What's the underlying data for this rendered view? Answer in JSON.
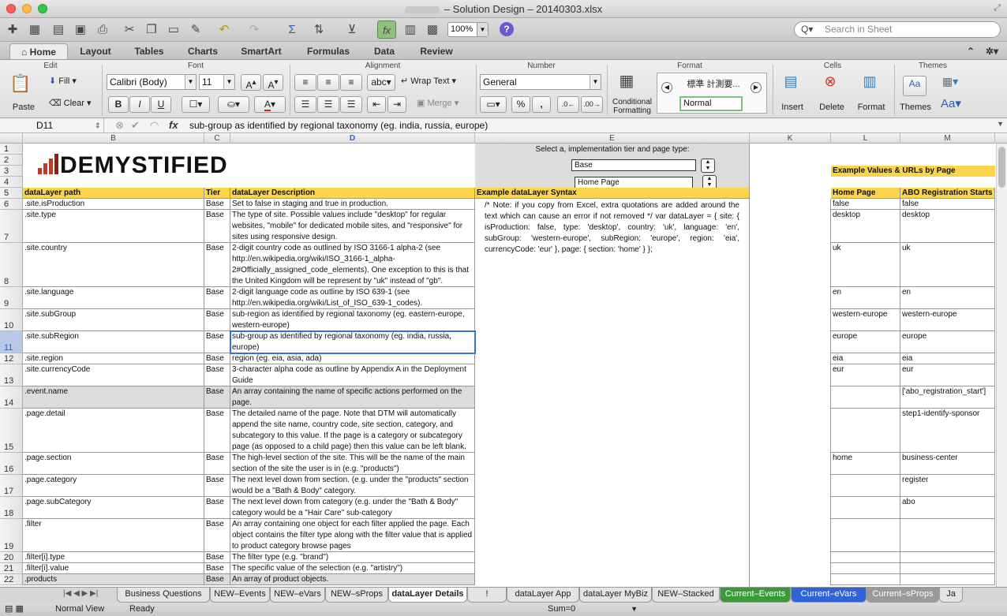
{
  "window": {
    "title": "– Solution Design – 20140303.xlsx",
    "colors": {
      "close": "#fc605c",
      "minimize": "#fdbc40",
      "zoom": "#34c84a",
      "header_yellow": "#fcd44b"
    }
  },
  "toolbar": {
    "zoom": "100%",
    "search_placeholder": "Search in Sheet"
  },
  "ribbon_tabs": [
    "Home",
    "Layout",
    "Tables",
    "Charts",
    "SmartArt",
    "Formulas",
    "Data",
    "Review"
  ],
  "ribbon": {
    "groups": [
      "Edit",
      "Font",
      "Alignment",
      "Number",
      "Format",
      "Cells",
      "Themes"
    ],
    "paste": "Paste",
    "fill": "Fill",
    "clear": "Clear",
    "font_name": "Calibri (Body)",
    "font_size": "11",
    "bold": "B",
    "italic": "I",
    "underline": "U",
    "wrap_text": "Wrap Text",
    "merge": "Merge",
    "number_format": "General",
    "percent": "%",
    "comma": ",",
    "conditional": "Conditional",
    "formatting": "Formatting",
    "style_preview": "標準 計測要...",
    "style_normal": "Normal",
    "insert": "Insert",
    "delete": "Delete",
    "format": "Format",
    "themes": "Themes"
  },
  "formula_bar": {
    "cell_ref": "D11",
    "fx": "fx",
    "formula": "sub-group as identified by regional taxonomy (eg. india, russia, europe)"
  },
  "columns": [
    "B",
    "C",
    "D",
    "E",
    "K",
    "L",
    "M"
  ],
  "sheet": {
    "logo": "DEMYSTIFIED",
    "select_prompt": "Select a, implementation tier and page type:",
    "tier_value": "Base",
    "page_value": "Home Page",
    "example_header": "Example Values & URLs by Page",
    "headers": {
      "path": "dataLayer path",
      "tier": "Tier",
      "desc": "dataLayer Description",
      "syntax": "Example dataLayer Syntax",
      "home": "Home Page",
      "abo": "ABO Registration Starts"
    },
    "syntax_text": "/* Note: if you copy from Excel, extra quotations are added around the text which can cause an error if not removed */ var dataLayer = {    site: {      isProduction: false,      type: 'desktop',      country: 'uk', language: 'en',      subGroup: 'western-europe',      subRegion: 'europe',      region: 'eia',      currencyCode: 'eur'    },    page: {      section: 'home'    } };",
    "rows": [
      {
        "num": "6",
        "path": ".site.isProduction",
        "tier": "Base",
        "desc": "Set to false in staging and true in production.",
        "home": "false",
        "abo": "false"
      },
      {
        "num": "7",
        "path": ".site.type",
        "tier": "Base",
        "desc": "The type of site. Possible values include \"desktop\" for regular websites, \"mobile\" for dedicated mobile sites, and \"responsive\" for sites using responsive design.",
        "home": "desktop",
        "abo": "desktop"
      },
      {
        "num": "8",
        "path": ".site.country",
        "tier": "Base",
        "desc": "2-digit country code as outlined by ISO 3166-1 alpha-2 (see http://en.wikipedia.org/wiki/ISO_3166-1_alpha-2#Officially_assigned_code_elements). One exception to this is that the United Kingdom will be represent by \"uk\" instead of \"gb\".",
        "home": "uk",
        "abo": "uk"
      },
      {
        "num": "9",
        "path": ".site.language",
        "tier": "Base",
        "desc": "2-digit language code as outline by ISO 639-1 (see http://en.wikipedia.org/wiki/List_of_ISO_639-1_codes).",
        "home": "en",
        "abo": "en"
      },
      {
        "num": "10",
        "path": ".site.subGroup",
        "tier": "Base",
        "desc": "sub-region as identified by regional taxonomy (eg. eastern-europe, western-europe)",
        "home": "western-europe",
        "abo": "western-europe"
      },
      {
        "num": "11",
        "path": ".site.subRegion",
        "tier": "Base",
        "desc": "sub-group as identified by regional taxonomy (eg. india, russia, europe)",
        "home": "europe",
        "abo": "europe"
      },
      {
        "num": "12",
        "path": ".site.region",
        "tier": "Base",
        "desc": "region (eg. eia, asia, ada)",
        "home": "eia",
        "abo": "eia"
      },
      {
        "num": "13",
        "path": ".site.currencyCode",
        "tier": "Base",
        "desc": "3-character alpha code as outline by Appendix A in the Deployment Guide",
        "home": "eur",
        "abo": "eur"
      },
      {
        "num": "14",
        "path": ".event.name",
        "tier": "Base",
        "desc": "An array containing the name of specific actions performed on the page.",
        "home": "",
        "abo": "['abo_registration_start']"
      },
      {
        "num": "15",
        "path": ".page.detail",
        "tier": "Base",
        "desc": "The detailed name of the page. Note that DTM will automatically append the site name, country code, site section, category, and subcategory to this value. If the page is a category or subcategory page (as opposed to a child page) then this value can be left blank.",
        "home": "",
        "abo": "step1-identify-sponsor"
      },
      {
        "num": "16",
        "path": ".page.section",
        "tier": "Base",
        "desc": "The high-level section of the site. This will be the name of the main section of the site the user is in (e.g. \"products\")",
        "home": "home",
        "abo": "business-center"
      },
      {
        "num": "17",
        "path": ".page.category",
        "tier": "Base",
        "desc": "The next level down from section. (e.g. under the \"products\" section would be a  \"Bath & Body\" category.",
        "home": "",
        "abo": "register"
      },
      {
        "num": "18",
        "path": ".page.subCategory",
        "tier": "Base",
        "desc": "The next level down from category (e.g. under the \"Bath & Body\" category would be a  \"Hair Care\" sub-category",
        "home": "",
        "abo": "abo"
      },
      {
        "num": "19",
        "path": ".filter",
        "tier": "Base",
        "desc": "An array containing one object for each filter applied the page. Each object contains the filter type along with the filter value that is applied to product category browse pages",
        "home": "",
        "abo": ""
      },
      {
        "num": "20",
        "path": ".filter[i].type",
        "tier": "Base",
        "desc": "The filter type (e.g. \"brand\")",
        "home": "",
        "abo": ""
      },
      {
        "num": "21",
        "path": ".filter[i].value",
        "tier": "Base",
        "desc": "The specific value of the selection (e.g. \"artistry\")",
        "home": "",
        "abo": ""
      },
      {
        "num": "22",
        "path": ".products",
        "tier": "Base",
        "desc": "An array of product objects.",
        "home": "",
        "abo": ""
      }
    ],
    "top_rows": [
      "1",
      "2",
      "3",
      "4",
      "5"
    ]
  },
  "sheet_tabs": [
    {
      "label": "Business Questions",
      "color": "#e4e4e4"
    },
    {
      "label": "NEW–Events",
      "color": "#e4e4e4"
    },
    {
      "label": "NEW–eVars",
      "color": "#e4e4e4"
    },
    {
      "label": "NEW–sProps",
      "color": "#e4e4e4"
    },
    {
      "label": "dataLayer Details",
      "color": "#ffffff"
    },
    {
      "label": "!",
      "color": "#e4e4e4"
    },
    {
      "label": "dataLayer App",
      "color": "#e4e4e4"
    },
    {
      "label": "dataLayer MyBiz",
      "color": "#e4e4e4"
    },
    {
      "label": "NEW–Stacked",
      "color": "#e4e4e4"
    },
    {
      "label": "Current–Events",
      "color": "#3a9a3a"
    },
    {
      "label": "Current–eVars",
      "color": "#2f63d6"
    },
    {
      "label": "Current–sProps",
      "color": "#9a9a9a"
    },
    {
      "label": "Ja",
      "color": "#e4e4e4"
    }
  ],
  "status": {
    "view": "Normal View",
    "state": "Ready",
    "sum": "Sum=0"
  }
}
